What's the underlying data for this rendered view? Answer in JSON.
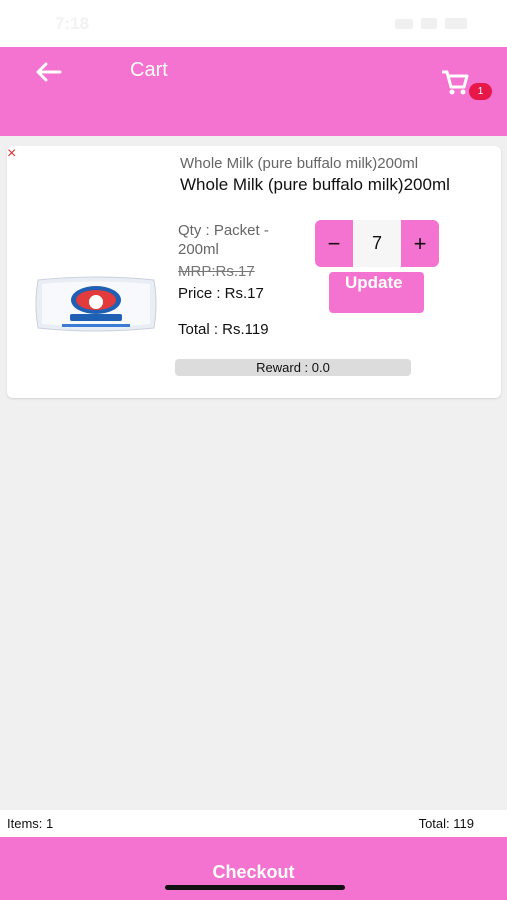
{
  "status_bar": {
    "time": "7:18"
  },
  "header": {
    "title": "Cart",
    "back_icon": "arrow-left-icon",
    "cart_icon": "shopping-cart-icon",
    "cart_count": "1"
  },
  "cart_items": [
    {
      "subtitle": "Whole Milk (pure buffalo milk)200ml",
      "name": "Whole Milk (pure buffalo milk)200ml",
      "qty": "Qty : Packet - 200ml",
      "mrp": "MRP:Rs.17",
      "price": "Price : Rs.17",
      "total": "Total : Rs.119",
      "quantity": "7",
      "minus_label": "−",
      "plus_label": "+",
      "update_label": "Update",
      "reward": "Reward : 0.0",
      "remove_label": "×",
      "image_brand": "MASOAH'S",
      "image_subbrand": "DAIRY MILK"
    }
  ],
  "summary": {
    "items": "Items: 1",
    "total": "Total: 119"
  },
  "checkout_label": "Checkout",
  "colors": {
    "accent": "#f472d0",
    "badge": "#e8174a",
    "remove": "#d9302c"
  }
}
